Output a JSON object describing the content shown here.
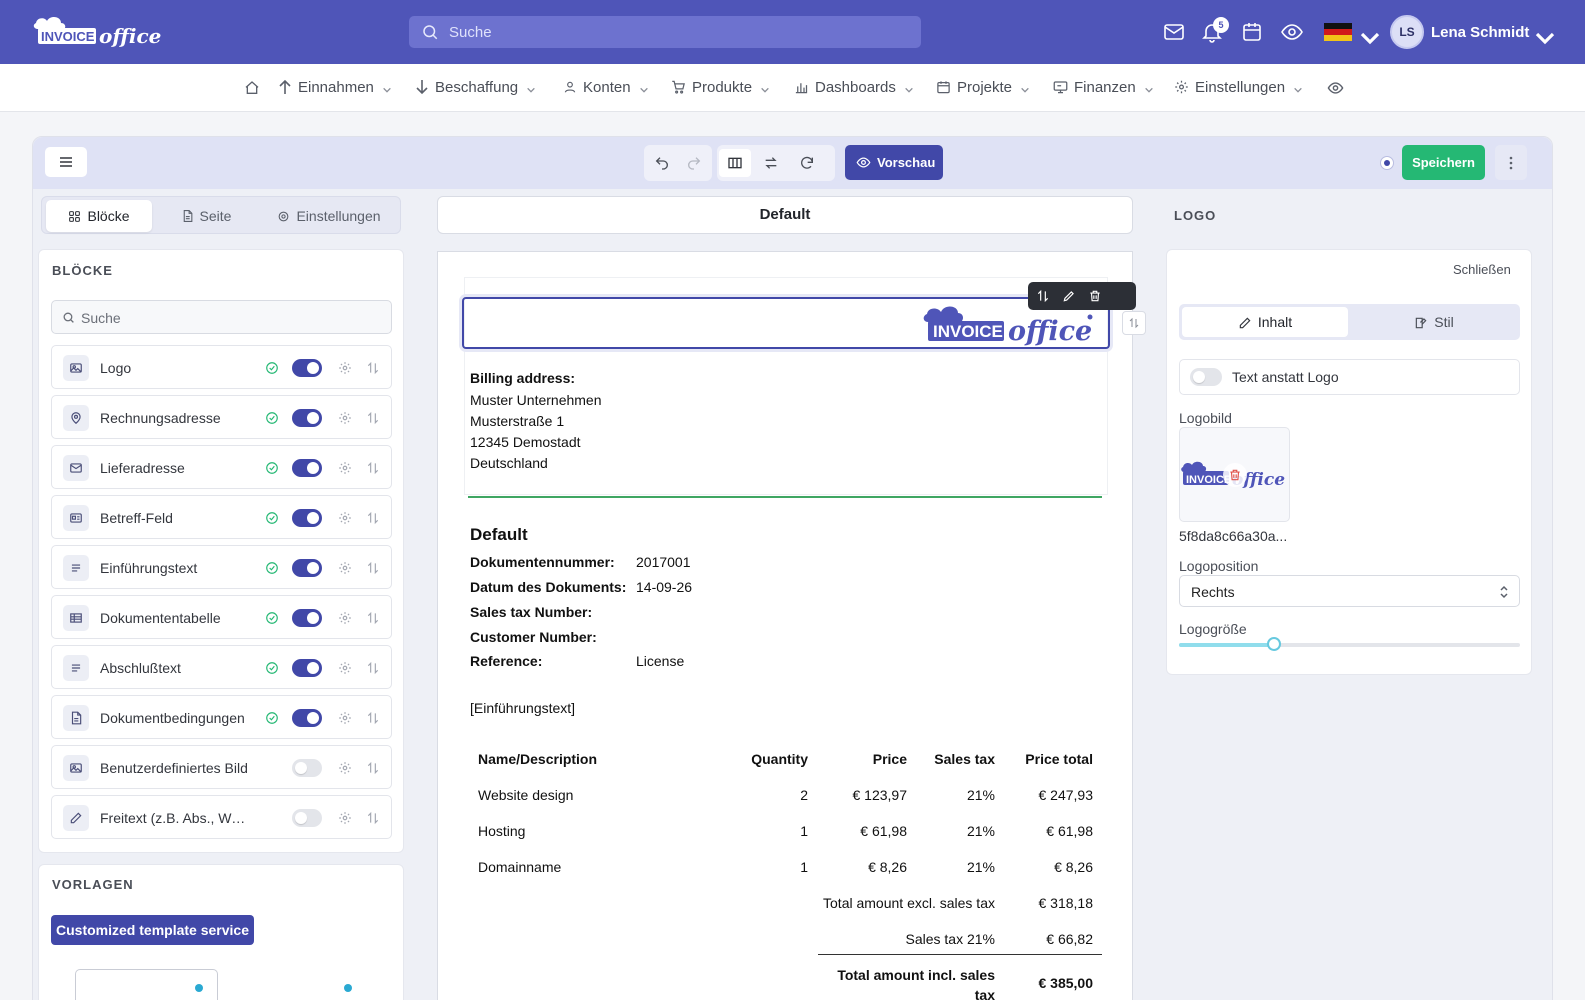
{
  "topbar": {
    "brand_text": "INVOICE office",
    "search_placeholder": "Suche",
    "notification_count": "5",
    "user_initials": "LS",
    "user_name": "Lena Schmidt",
    "color": "#4f55b8"
  },
  "menu": {
    "items": [
      {
        "label": "Einnahmen",
        "icon": "arrow-up-icon"
      },
      {
        "label": "Beschaffung",
        "icon": "arrow-down-icon"
      },
      {
        "label": "Konten",
        "icon": "user-icon"
      },
      {
        "label": "Produkte",
        "icon": "cart-icon"
      },
      {
        "label": "Dashboards",
        "icon": "bar-chart-icon"
      },
      {
        "label": "Projekte",
        "icon": "calendar-icon"
      },
      {
        "label": "Finanzen",
        "icon": "monitor-icon"
      },
      {
        "label": "Einstellungen",
        "icon": "gear-icon"
      }
    ]
  },
  "toolbar": {
    "preview_label": "Vorschau",
    "save_label": "Speichern",
    "accent": "#4148a8",
    "save_color": "#25b874"
  },
  "left": {
    "tabs": [
      "Blöcke",
      "Seite",
      "Einstellungen"
    ],
    "panel_title": "BLÖCKE",
    "search_placeholder": "Suche",
    "blocks": [
      {
        "label": "Logo",
        "enabled": true,
        "icon": "image-icon"
      },
      {
        "label": "Rechnungsadresse",
        "enabled": true,
        "icon": "location-pin-icon"
      },
      {
        "label": "Lieferadresse",
        "enabled": true,
        "icon": "mail-icon"
      },
      {
        "label": "Betreff-Feld",
        "enabled": true,
        "icon": "id-card-icon"
      },
      {
        "label": "Einführungstext",
        "enabled": true,
        "icon": "text-lines-icon"
      },
      {
        "label": "Dokumententabelle",
        "enabled": true,
        "icon": "table-icon"
      },
      {
        "label": "Abschlußtext",
        "enabled": true,
        "icon": "text-lines-icon"
      },
      {
        "label": "Dokumentbedingungen",
        "enabled": true,
        "icon": "document-icon"
      },
      {
        "label": "Benutzerdefiniertes Bild",
        "enabled": false,
        "icon": "image-icon"
      },
      {
        "label": "Freitext (z.B. Abs., Werbetext)",
        "enabled": false,
        "icon": "edit-icon"
      }
    ],
    "templates_title": "VORLAGEN",
    "template_button": "Customized template service"
  },
  "center": {
    "doc_name": "Default",
    "billing_label": "Billing address:",
    "address": [
      "Muster Unternehmen",
      "Musterstraße 1",
      "12345 Demostadt",
      "Deutschland"
    ],
    "doc_title": "Default",
    "meta": [
      {
        "label": "Dokumentennummer:",
        "value": "2017001"
      },
      {
        "label": "Datum des Dokuments:",
        "value": "14-09-26"
      },
      {
        "label": "Sales tax Number:",
        "value": ""
      },
      {
        "label": "Customer Number:",
        "value": ""
      },
      {
        "label": "Reference:",
        "value": "License"
      }
    ],
    "intro_placeholder": "[Einführungstext]",
    "table_headers": [
      "Name/Description",
      "Quantity",
      "Price",
      "Sales tax",
      "Price total"
    ],
    "rows": [
      {
        "name": "Website design",
        "qty": "2",
        "price": "€ 123,97",
        "tax": "21%",
        "total": "€ 247,93"
      },
      {
        "name": "Hosting",
        "qty": "1",
        "price": "€ 61,98",
        "tax": "21%",
        "total": "€ 61,98"
      },
      {
        "name": "Domainname",
        "qty": "1",
        "price": "€ 8,26",
        "tax": "21%",
        "total": "€ 8,26"
      }
    ],
    "totals": [
      {
        "label": "Total amount excl. sales tax",
        "value": "€ 318,18"
      },
      {
        "label": "Sales tax 21%",
        "value": "€ 66,82"
      },
      {
        "label": "Total amount incl. sales tax",
        "value": "€ 385,00"
      }
    ]
  },
  "right": {
    "title": "LOGO",
    "close_label": "Schließen",
    "tabs": [
      "Inhalt",
      "Stil"
    ],
    "text_toggle_label": "Text anstatt Logo",
    "text_toggle_on": false,
    "logo_image_label": "Logobild",
    "logo_filename": "5f8da8c66a30a...",
    "position_label": "Logoposition",
    "position_value": "Rechts",
    "size_label": "Logogröße",
    "size_value": 0.28
  }
}
